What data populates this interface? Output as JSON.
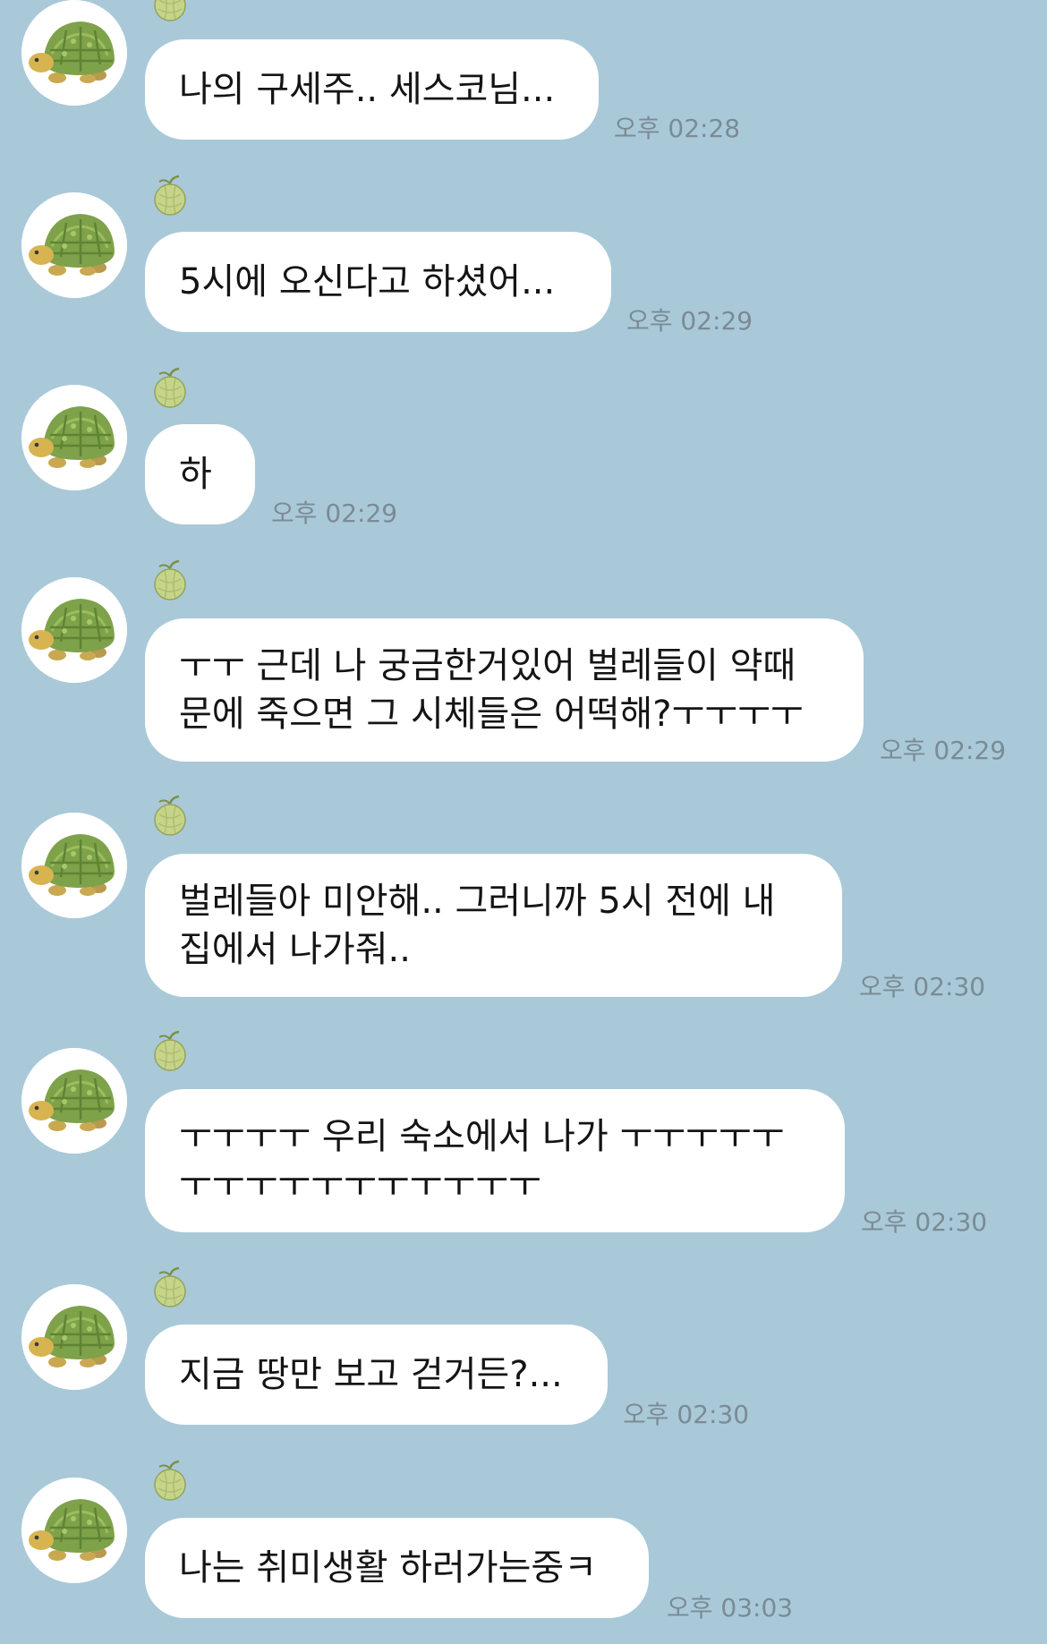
{
  "colors": {
    "background": "#a9c9d9",
    "bubble": "#ffffff",
    "time_text": "#7a8b95"
  },
  "messages": [
    {
      "text": "나의 구세주.. 세스코님...",
      "time": "오후 02:28",
      "avatar": "turtle-avatar-icon"
    },
    {
      "text": "5시에 오신다고 하셨어...",
      "time": "오후 02:29",
      "avatar": "turtle-avatar-icon"
    },
    {
      "text": "하",
      "time": "오후 02:29",
      "avatar": "turtle-avatar-icon"
    },
    {
      "text": "ㅜㅜ 근데 나 궁금한거있어 벌레들이 약때\n문에 죽으면 그 시체들은 어떡해?ㅜㅜㅜㅜ",
      "time": "오후 02:29",
      "avatar": "turtle-avatar-icon"
    },
    {
      "text": "벌레들아 미안해.. 그러니까 5시 전에 내\n집에서 나가줘..",
      "time": "오후 02:30",
      "avatar": "turtle-avatar-icon"
    },
    {
      "text": "ㅜㅜㅜㅜ 우리 숙소에서 나가 ㅜㅜㅜㅜㅜ\nㅜㅜㅜㅜㅜㅜㅜㅜㅜㅜㅜ",
      "time": "오후 02:30",
      "avatar": "turtle-avatar-icon"
    },
    {
      "text": "지금 땅만 보고 걷거든?...",
      "time": "오후 02:30",
      "avatar": "turtle-avatar-icon"
    },
    {
      "text": "나는 취미생활 하러가는중ㅋ",
      "time": "오후 03:03",
      "avatar": "turtle-avatar-icon"
    }
  ]
}
